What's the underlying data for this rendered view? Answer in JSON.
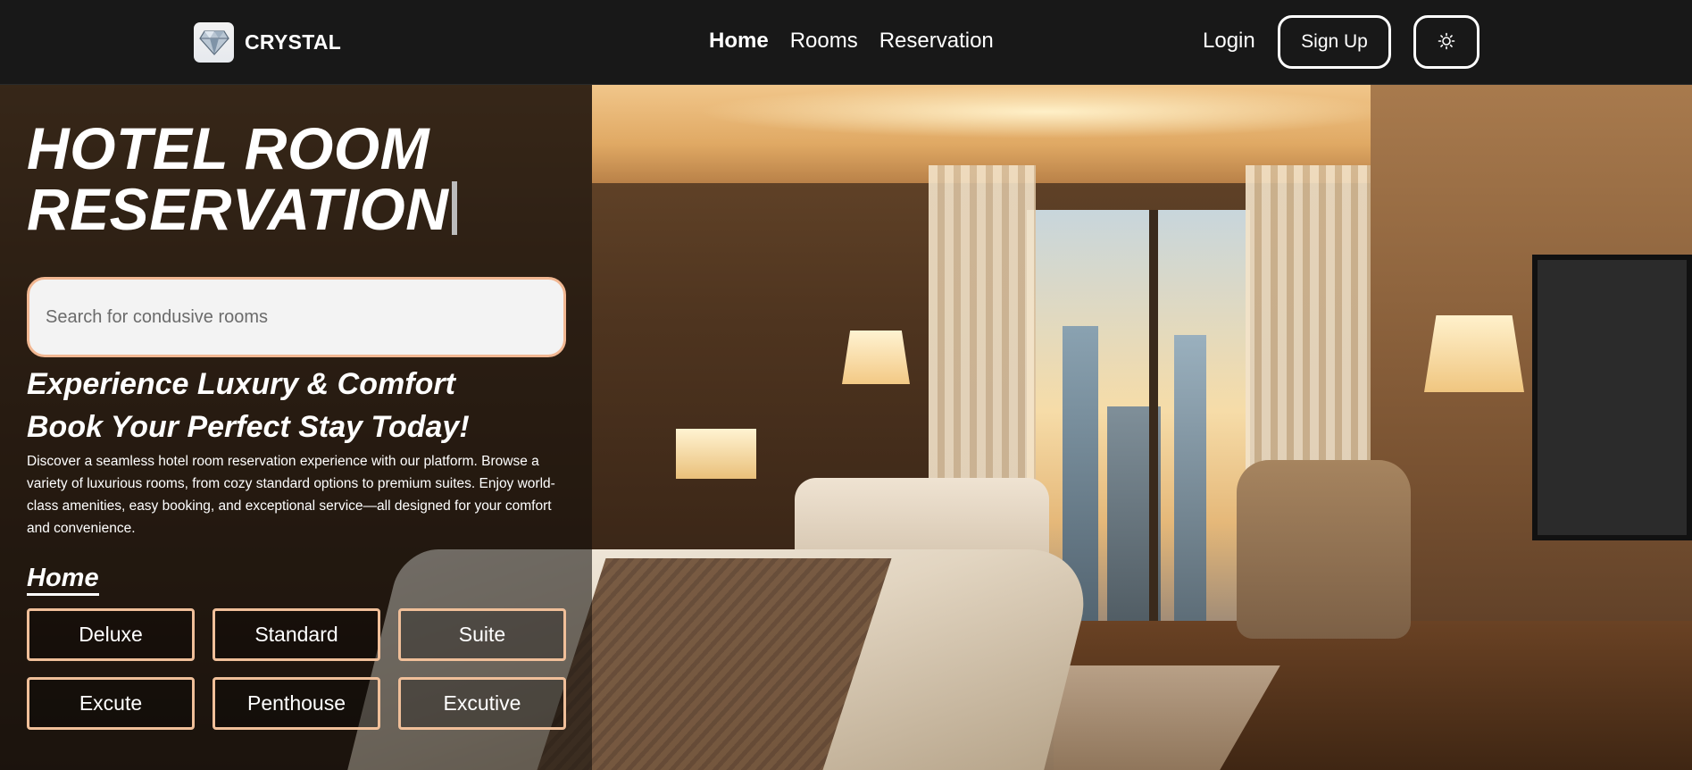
{
  "navbar": {
    "brand": "CRYSTAL",
    "logo_icon": "diamond-icon",
    "links": [
      {
        "label": "Home",
        "active": true
      },
      {
        "label": "Rooms",
        "active": false
      },
      {
        "label": "Reservation",
        "active": false
      }
    ],
    "login_label": "Login",
    "signup_label": "Sign Up",
    "theme_icon": "sun-icon"
  },
  "hero": {
    "title_line1": "HOTEL ROOM",
    "title_line2": "RESERVATION",
    "search_placeholder": "Search for condusive rooms",
    "tagline_line1": "Experience Luxury & Comfort",
    "tagline_line2": "Book Your Perfect Stay Today!",
    "description": "Discover a seamless hotel room reservation experience with our platform. Browse a variety of luxurious rooms, from cozy standard options to premium suites. Enjoy world-class amenities, easy booking, and exceptional service—all designed for your comfort and convenience.",
    "section_label": "Home",
    "room_types": [
      "Deluxe",
      "Standard",
      "Suite",
      "Excute",
      "Penthouse",
      "Excutive"
    ]
  },
  "colors": {
    "navbar_bg": "#181818",
    "button_border_accent": "#f0bf99",
    "search_border": "#f1b792"
  }
}
